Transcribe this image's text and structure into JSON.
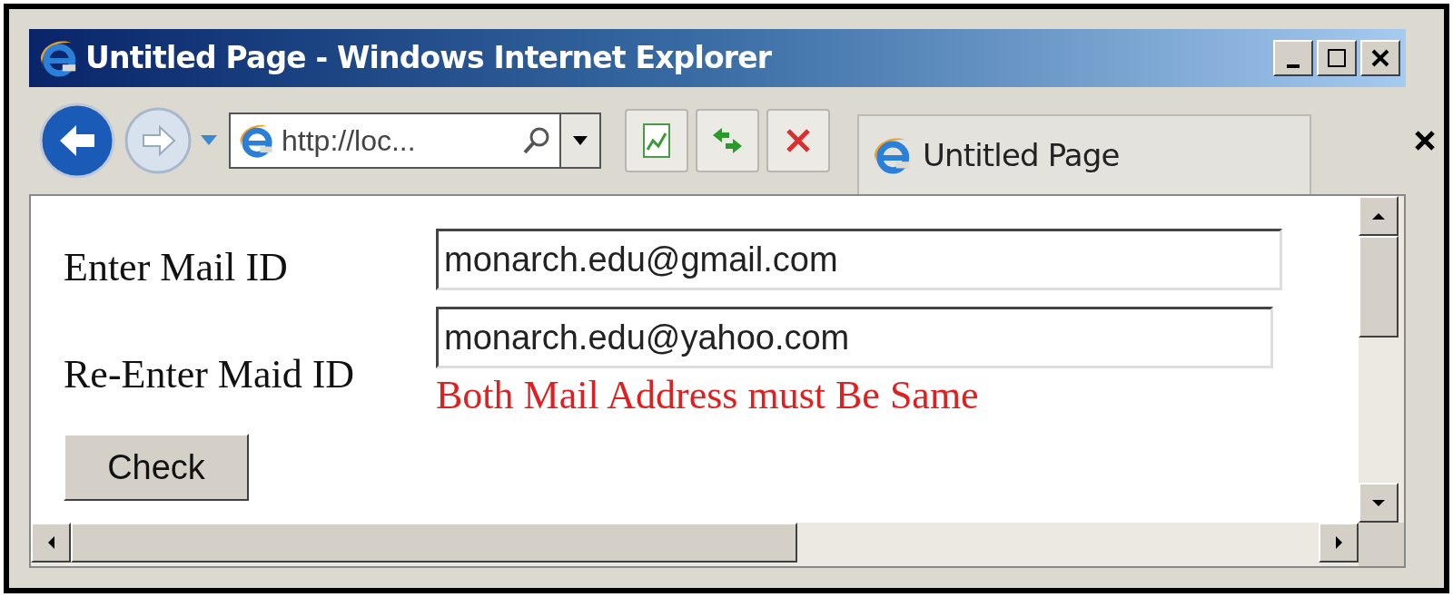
{
  "window": {
    "title": "Untitled Page - Windows Internet Explorer"
  },
  "address_bar": {
    "value": "http://loc..."
  },
  "tab": {
    "label": "Untitled Page"
  },
  "form": {
    "fields": [
      {
        "label": "Enter Mail ID",
        "value": "monarch.edu@gmail.com"
      },
      {
        "label": "Re-Enter Maid ID",
        "value": "monarch.edu@yahoo.com"
      }
    ],
    "error": "Both Mail Address must Be Same",
    "button": "Check"
  }
}
